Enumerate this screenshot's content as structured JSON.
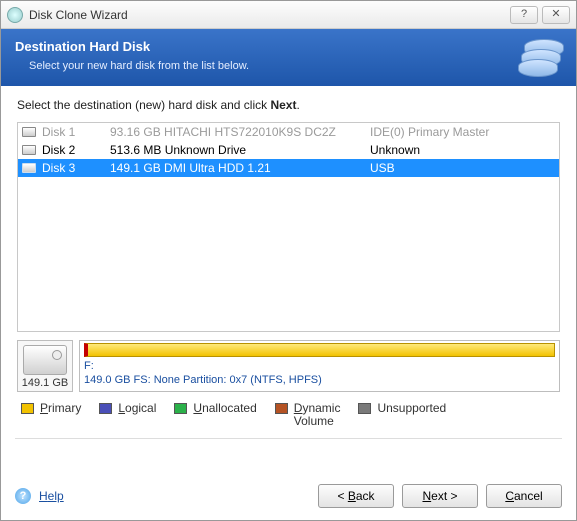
{
  "window": {
    "title": "Disk Clone Wizard"
  },
  "banner": {
    "heading": "Destination Hard Disk",
    "subtext": "Select your new hard disk from the list below."
  },
  "instruction": {
    "prefix": "Select the destination (new) hard disk and click ",
    "bold": "Next",
    "suffix": "."
  },
  "disks": [
    {
      "name": "Disk 1",
      "desc": "93.16 GB  HITACHI HTS722010K9S DC2Z",
      "iface": "IDE(0) Primary Master",
      "disabled": true,
      "selected": false
    },
    {
      "name": "Disk 2",
      "desc": "513.6 MB  Unknown Drive",
      "iface": "Unknown",
      "disabled": false,
      "selected": false
    },
    {
      "name": "Disk 3",
      "desc": "149.1 GB  DMI Ultra HDD 1.21",
      "iface": "USB",
      "disabled": false,
      "selected": true
    }
  ],
  "detail": {
    "capacity": "149.1 GB",
    "drive": "F:",
    "fsline": "149.0 GB  FS: None Partition: 0x7 (NTFS, HPFS)"
  },
  "legend": {
    "primary": "Primary",
    "logical": "Logical",
    "unallocated": "Unallocated",
    "dynamic_line1": "Dynamic",
    "dynamic_line2": "Volume",
    "unsupported": "Unsupported",
    "colors": {
      "primary": "#f2c200",
      "logical": "#4a4fb8",
      "unallocated": "#2bb14a",
      "dynamic": "#b55324",
      "unsupported": "#7a7a7a"
    }
  },
  "footer": {
    "help": "Help",
    "back": "Back",
    "next": "Next",
    "cancel": "Cancel"
  }
}
